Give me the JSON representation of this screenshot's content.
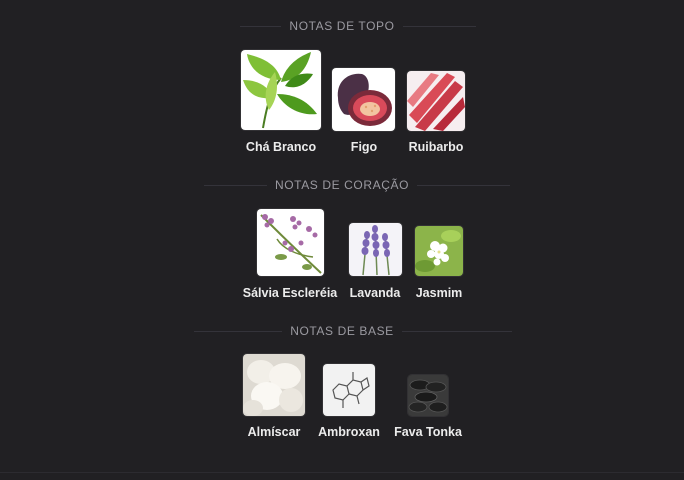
{
  "sections": {
    "top": {
      "title": "NOTAS DE TOPO",
      "notes": [
        {
          "name": "Chá Branco",
          "icon": "white-tea-leaves-icon"
        },
        {
          "name": "Figo",
          "icon": "fig-icon"
        },
        {
          "name": "Ruibarbo",
          "icon": "rhubarb-icon"
        }
      ]
    },
    "heart": {
      "title": "NOTAS DE CORAÇÃO",
      "notes": [
        {
          "name": "Sálvia Escleréia",
          "icon": "clary-sage-icon"
        },
        {
          "name": "Lavanda",
          "icon": "lavender-icon"
        },
        {
          "name": "Jasmim",
          "icon": "jasmine-icon"
        }
      ]
    },
    "base": {
      "title": "NOTAS DE BASE",
      "notes": [
        {
          "name": "Almíscar",
          "icon": "musk-icon"
        },
        {
          "name": "Ambroxan",
          "icon": "ambroxan-molecule-icon"
        },
        {
          "name": "Fava Tonka",
          "icon": "tonka-beans-icon"
        }
      ]
    }
  }
}
